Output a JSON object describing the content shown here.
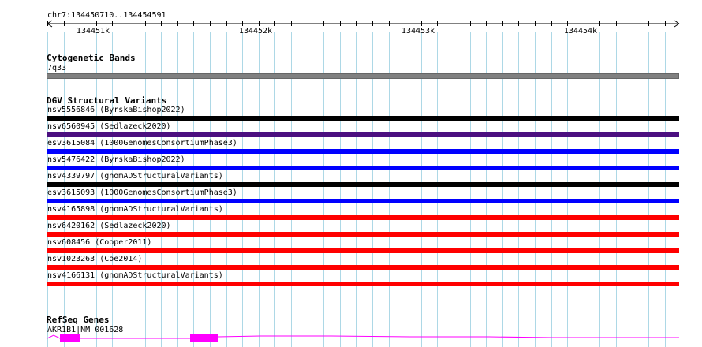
{
  "ruler": {
    "location": "chr7:134450710..134454591",
    "ticks": [
      "134451k",
      "134452k",
      "134453k",
      "134454k"
    ]
  },
  "cytoband": {
    "title": "Cytogenetic Bands",
    "label": "7q33",
    "color": "#808080"
  },
  "dgv": {
    "title": "DGV Structural Variants",
    "variants": [
      {
        "label": "nsv5556846 (ByrskaBishop2022)",
        "color": "#000000"
      },
      {
        "label": "nsv6560945 (Sedlazeck2020)",
        "color": "#4b0f80"
      },
      {
        "label": "esv3615084 (1000GenomesConsortiumPhase3)",
        "color": "#0000ff"
      },
      {
        "label": "nsv5476422 (ByrskaBishop2022)",
        "color": "#0000ff"
      },
      {
        "label": "nsv4339797 (gnomADStructuralVariants)",
        "color": "#000000"
      },
      {
        "label": "esv3615093 (1000GenomesConsortiumPhase3)",
        "color": "#0000ff"
      },
      {
        "label": "nsv4165898 (gnomADStructuralVariants)",
        "color": "#ff0000"
      },
      {
        "label": "nsv6420162 (Sedlazeck2020)",
        "color": "#ff0000"
      },
      {
        "label": "nsv608456 (Cooper2011)",
        "color": "#ff0000"
      },
      {
        "label": "nsv1023263 (Coe2014)",
        "color": "#ff0000"
      },
      {
        "label": "nsv4166131 (gnomADStructuralVariants)",
        "color": "#ff0000"
      }
    ]
  },
  "refseq": {
    "title": "RefSeq Genes",
    "gene_label": "AKR1B1|NM_001628",
    "color": "#ff00ff"
  },
  "colors": {
    "grid_line": "#add8e6",
    "ruler": "#000000"
  }
}
